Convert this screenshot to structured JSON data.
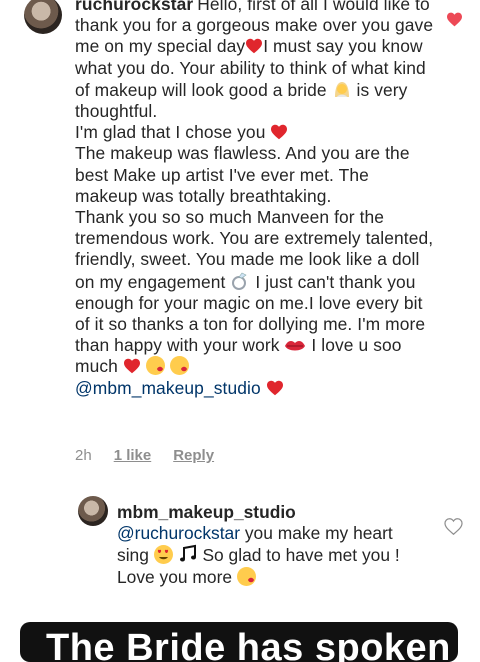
{
  "comment": {
    "username": "ruchurockstar",
    "lines": [
      "Hello, first of all I would like to thank you for a gorgeous make over you gave me on my special day",
      "I must say you know what you do. Your ability to think of what kind of makeup will look good a bride",
      "is very thoughtful.",
      "I'm glad that I chose you",
      "The makeup was flawless. And you are the best Make up artist I've ever met. The makeup was totally breathtaking.",
      "Thank you so so much Manveen for the tremendous work. You are extremely talented, friendly, sweet. You made me look like a doll on my engagement",
      "I just can't thank you enough for your magic on me.I love every bit of it so thanks a ton for dollying me. I'm more than happy with your work",
      "I love u soo much",
      "@mbm_makeup_studio"
    ],
    "timestamp": "2h",
    "likes": "1 like",
    "reply_label": "Reply",
    "liked": true,
    "heart_color": "#ed4956"
  },
  "reply": {
    "username": "mbm_makeup_studio",
    "mention": "@ruchurockstar",
    "line1": "you make my heart sing",
    "line2": "So glad to have met you !",
    "line3": "Love you more"
  },
  "banner": {
    "text": "The Bride has spoken !"
  },
  "colors": {
    "mention": "#003569",
    "meta": "#8e8e8e",
    "text": "#262626",
    "heart_red": "#e0262d"
  },
  "icons": [
    "heart-like-icon",
    "heart-outline-icon",
    "red-heart-emoji",
    "bride-emoji",
    "ring-emoji",
    "kiss-mark-emoji",
    "kissing-face-emoji",
    "heart-eyes-emoji",
    "music-notes-emoji"
  ]
}
